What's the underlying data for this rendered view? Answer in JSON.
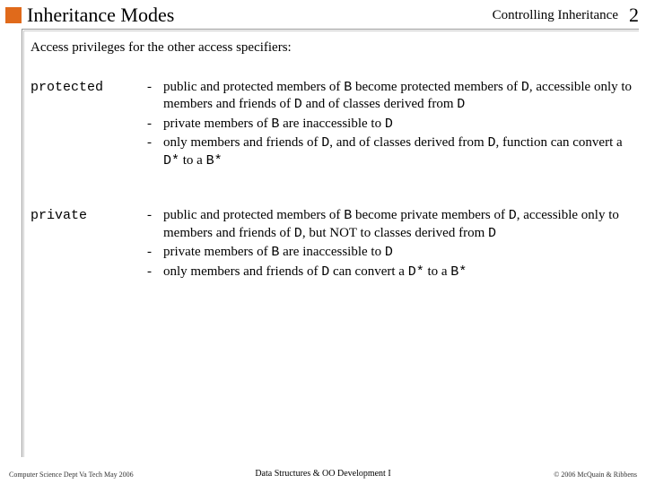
{
  "header": {
    "title": "Inheritance Modes",
    "section": "Controlling Inheritance",
    "page_number": "2"
  },
  "intro": "Access privileges for the other access specifiers:",
  "specs": [
    {
      "label": "protected",
      "items": [
        {
          "pre1": "public and protected members of ",
          "c1": "B",
          "mid1": " become protected members of ",
          "c2": "D",
          "mid2": ", accessible only to members and friends of ",
          "c3": "D",
          "mid3": " and of classes derived from ",
          "c4": "D",
          "post": ""
        },
        {
          "pre1": "private members of ",
          "c1": "B",
          "mid1": " are inaccessible to ",
          "c2": "D",
          "post": ""
        },
        {
          "pre1": "only members and friends of ",
          "c1": "D",
          "mid1": ", and of classes derived from ",
          "c2": "D",
          "mid2": ", function can convert a ",
          "c3": "D*",
          "mid3": " to a ",
          "c4": "B*",
          "post": ""
        }
      ]
    },
    {
      "label": "private",
      "items": [
        {
          "pre1": "public and protected members of ",
          "c1": "B",
          "mid1": " become private members of ",
          "c2": "D",
          "mid2": ", accessible only to members and friends of ",
          "c3": "D",
          "mid3": ", but NOT to classes derived from ",
          "c4": "D",
          "post": ""
        },
        {
          "pre1": "private members of ",
          "c1": "B",
          "mid1": " are inaccessible to ",
          "c2": "D",
          "post": ""
        },
        {
          "pre1": " only members and friends of ",
          "c1": "D",
          "mid1": " can convert a ",
          "c2": "D*",
          "mid2": " to a ",
          "c3": "B*",
          "post": ""
        }
      ]
    }
  ],
  "footer": {
    "left": "Computer Science Dept Va Tech May 2006",
    "center": "Data Structures & OO Development I",
    "right": "© 2006  McQuain & Ribbens"
  }
}
